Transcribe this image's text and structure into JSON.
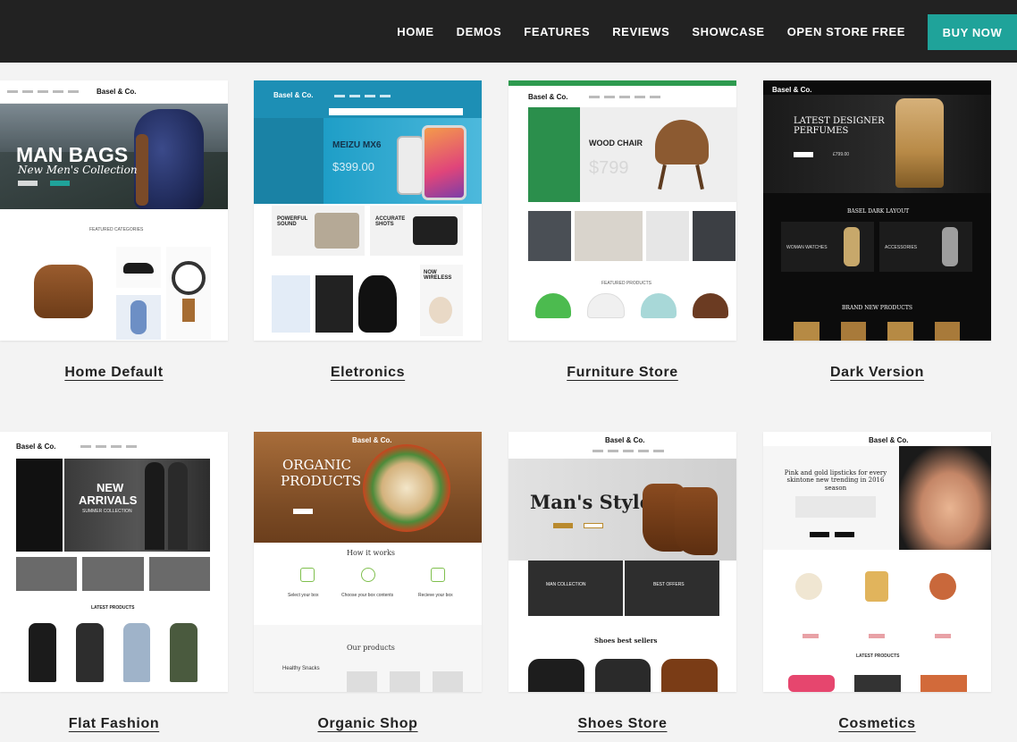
{
  "nav": {
    "items": [
      "HOME",
      "DEMOS",
      "FEATURES",
      "REVIEWS",
      "SHOWCASE",
      "OPEN STORE FREE"
    ],
    "buy_now": "BUY NOW"
  },
  "demos": [
    {
      "title": "Home Default"
    },
    {
      "title": "Eletronics"
    },
    {
      "title": "Furniture Store"
    },
    {
      "title": "Dark Version"
    },
    {
      "title": "Flat Fashion"
    },
    {
      "title": "Organic Shop"
    },
    {
      "title": "Shoes Store"
    },
    {
      "title": "Cosmetics"
    }
  ],
  "previews": {
    "home": {
      "logo": "Basel & Co.",
      "headline": "MAN BAGS",
      "tagline": "New Men's Collection",
      "section": "FEATURED CATEGORIES"
    },
    "electronics": {
      "logo": "Basel & Co.",
      "phone": "MEIZU MX6",
      "price": "$399.00",
      "promo1": "POWERFUL SOUND",
      "promo2": "ACCURATE SHOTS",
      "promo3": "NOW WIRELESS"
    },
    "furniture": {
      "logo": "Basel & Co.",
      "headline": "WOOD CHAIR",
      "price": "$799",
      "section": "FEATURED PRODUCTS"
    },
    "dark": {
      "logo": "Basel & Co.",
      "headline": "LATEST DESIGNER PERFUMES",
      "price": "£799.00",
      "section": "BASEL DARK LAYOUT",
      "watch1": "WOMAN WATCHES",
      "watch2": "ACCESSORIES",
      "new": "BRAND NEW PRODUCTS"
    },
    "fashion": {
      "logo": "Basel & Co.",
      "headline1": "NEW",
      "headline2": "ARRIVALS",
      "sub": "SUMMER COLLECTION",
      "section": "LATEST PRODUCTS"
    },
    "organic": {
      "logo": "Basel & Co.",
      "headline1": "ORGANIC",
      "headline2": "PRODUCTS",
      "how": "How it works",
      "step1": "Select your box",
      "step2": "Choose your box contents",
      "step3": "Recieve your box",
      "products": "Our products",
      "snacks": "Healthy Snacks"
    },
    "shoes": {
      "logo": "Basel & Co.",
      "headline": "Man's Style",
      "tile1": "MAN COLLECTION",
      "tile2": "BEST OFFERS",
      "sellers": "Shoes best sellers"
    },
    "cosmetics": {
      "logo": "Basel & Co.",
      "headline": "Pink and gold lipsticks for every skintone new trending in 2016 season",
      "section": "LATEST PRODUCTS"
    }
  }
}
